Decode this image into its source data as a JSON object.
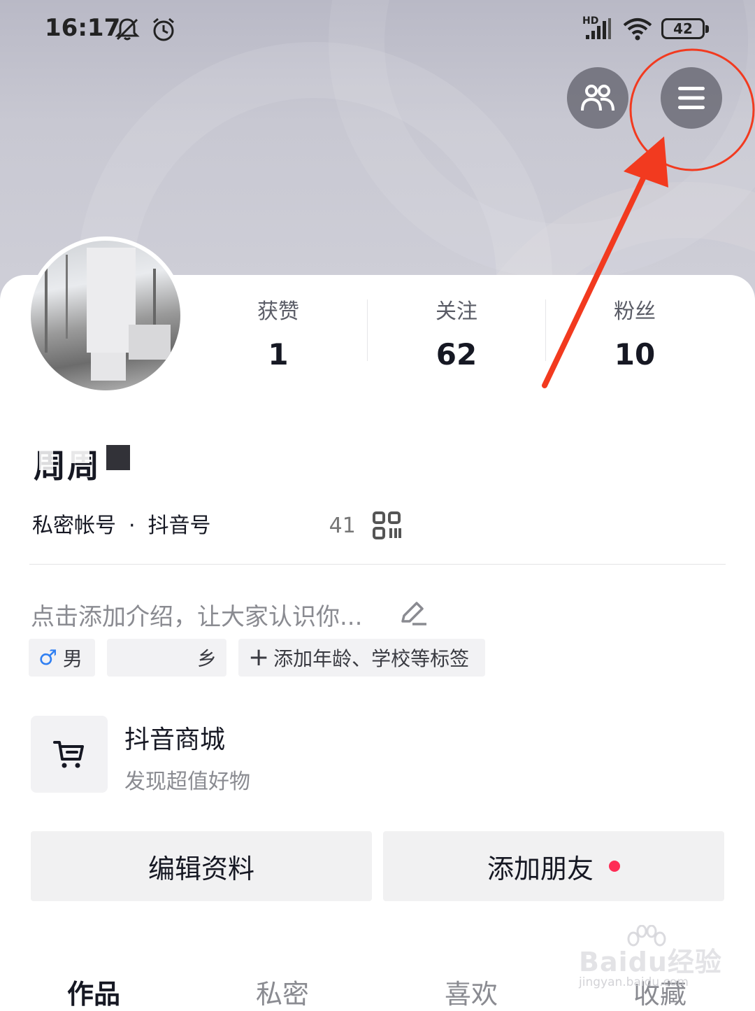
{
  "status_bar": {
    "time": "16:17",
    "battery": "42",
    "network_label": "HD"
  },
  "header": {
    "friends_icon": "friends-icon",
    "menu_icon": "hamburger-menu-icon"
  },
  "stats": [
    {
      "label": "获赞",
      "value": "1"
    },
    {
      "label": "关注",
      "value": "62"
    },
    {
      "label": "粉丝",
      "value": "10"
    }
  ],
  "profile": {
    "nickname": "周周",
    "account_type": "私密帐号",
    "douyin_id_label": "抖音号",
    "douyin_id_tail": "41",
    "bio_placeholder": "点击添加介绍，让大家认识你...",
    "tags": {
      "gender": "男",
      "location_tail": "乡",
      "add_tags": "添加年龄、学校等标签"
    }
  },
  "shop": {
    "title": "抖音商城",
    "subtitle": "发现超值好物"
  },
  "actions": {
    "edit_profile": "编辑资料",
    "add_friends": "添加朋友"
  },
  "tabs": [
    {
      "label": "作品",
      "active": true
    },
    {
      "label": "私密",
      "active": false
    },
    {
      "label": "喜欢",
      "active": false
    },
    {
      "label": "收藏",
      "active": false
    }
  ],
  "watermark": {
    "main": "Baidu经验",
    "sub": "jingyan.baidu.com"
  },
  "colors": {
    "accent_red": "#fe2c55",
    "annotation_red": "#f23a1f",
    "male_blue": "#2f7ff2"
  }
}
